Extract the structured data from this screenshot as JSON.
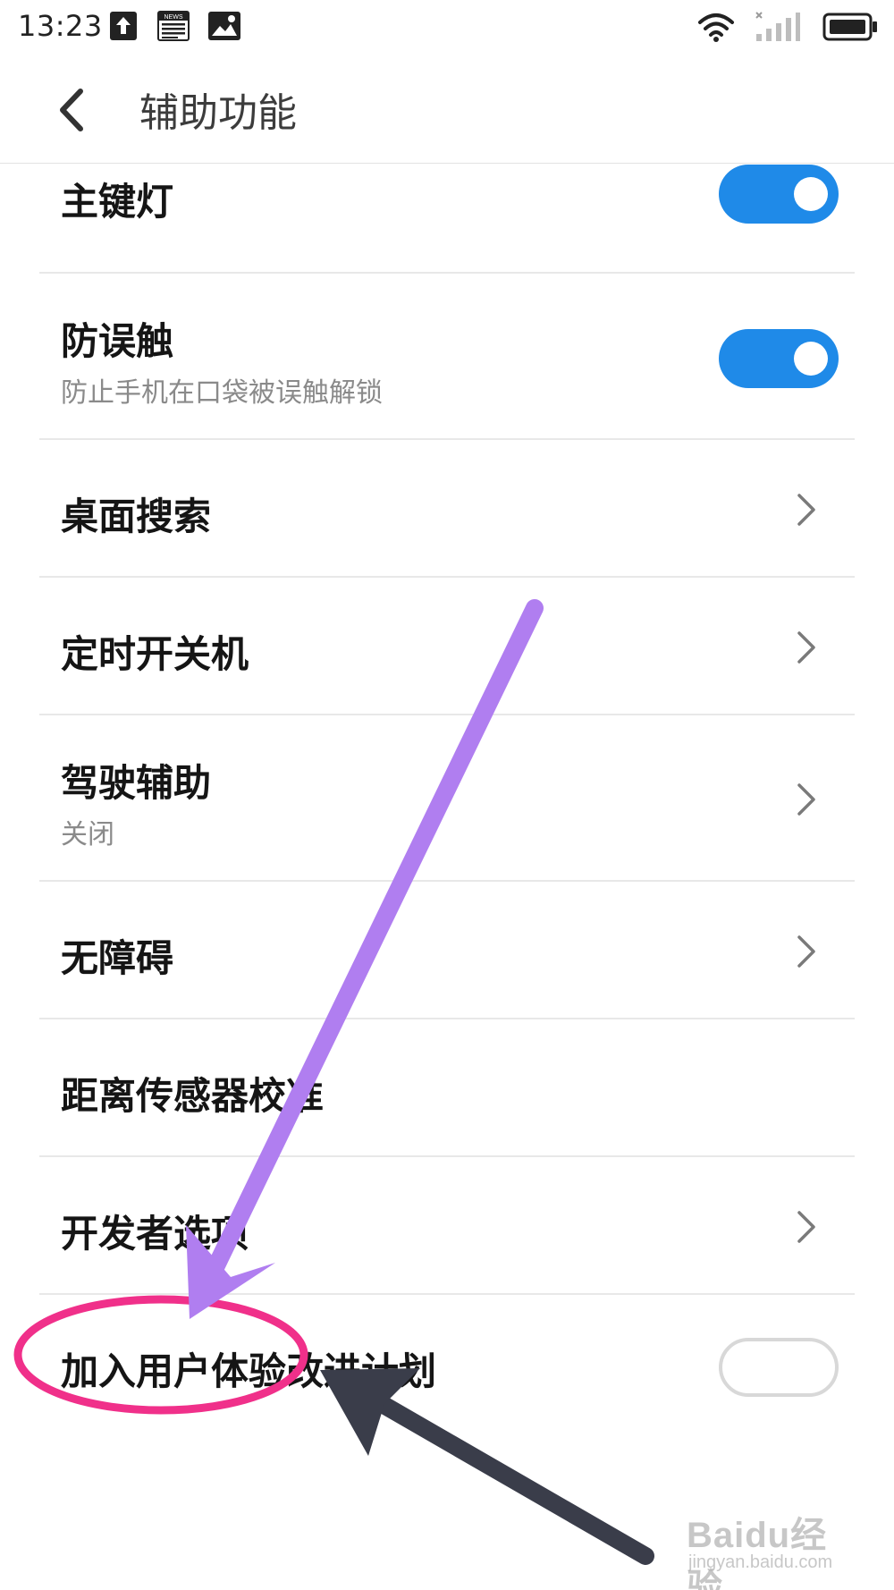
{
  "status_bar": {
    "time": "13:23",
    "icons": [
      "upload-icon",
      "news-icon",
      "image-icon",
      "wifi-icon",
      "signal-icon",
      "battery-icon"
    ],
    "news_label": "NEWS"
  },
  "header": {
    "title": "辅助功能",
    "back_icon": "chevron-left-icon"
  },
  "items": [
    {
      "title": "主键灯",
      "control": "toggle",
      "state": "on"
    },
    {
      "title": "防误触",
      "subtitle": "防止手机在口袋被误触解锁",
      "control": "toggle",
      "state": "on"
    },
    {
      "title": "桌面搜索",
      "control": "chevron"
    },
    {
      "title": "定时开关机",
      "control": "chevron"
    },
    {
      "title": "驾驶辅助",
      "subtitle": "关闭",
      "control": "chevron"
    },
    {
      "title": "无障碍",
      "control": "chevron"
    },
    {
      "title": "距离传感器校准",
      "control": "none"
    },
    {
      "title": "开发者选项",
      "control": "chevron"
    },
    {
      "title": "加入用户体验改进计划",
      "control": "toggle",
      "state": "off"
    }
  ],
  "colors": {
    "accent": "#1f8ae8",
    "annotation_purple": "#b07ef0",
    "annotation_pink": "#f0308a",
    "annotation_dark": "#3a3d4a"
  },
  "watermark": {
    "brand": "Baidu经验",
    "url": "jingyan.baidu.com"
  }
}
